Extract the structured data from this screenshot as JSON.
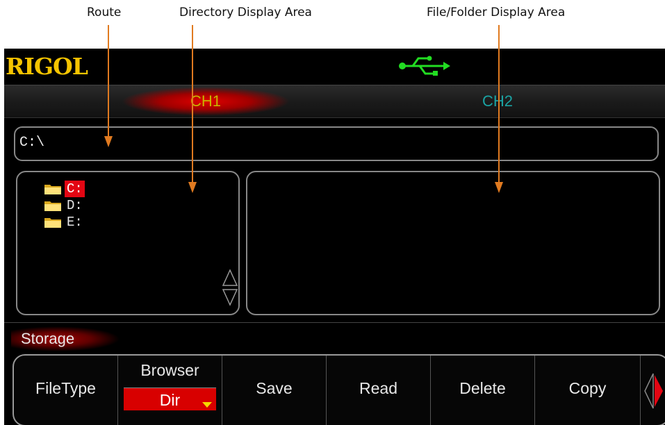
{
  "annotations": {
    "route": "Route",
    "directory": "Directory Display Area",
    "files": "File/Folder Display Area"
  },
  "brand": "RIGOL",
  "status": {
    "usb_icon": "usb-icon"
  },
  "channels": [
    {
      "label": "CH1",
      "active": true,
      "color": "#c8b400"
    },
    {
      "label": "CH2",
      "active": false,
      "color": "#1aa3a3"
    }
  ],
  "route": {
    "path": "C:\\"
  },
  "drives": [
    {
      "label": "C:",
      "selected": true
    },
    {
      "label": "D:",
      "selected": false
    },
    {
      "label": "E:",
      "selected": false
    }
  ],
  "menu": {
    "title": "Storage",
    "keys": [
      {
        "label": "FileType"
      },
      {
        "label": "Browser",
        "value": "Dir"
      },
      {
        "label": "Save"
      },
      {
        "label": "Read"
      },
      {
        "label": "Delete"
      },
      {
        "label": "Copy"
      }
    ],
    "next_page_icon": "right-arrow-icon"
  },
  "colors": {
    "accent": "#e30613",
    "logo": "#f5c400",
    "usb": "#22dd22",
    "arrow": "#e07a20"
  }
}
